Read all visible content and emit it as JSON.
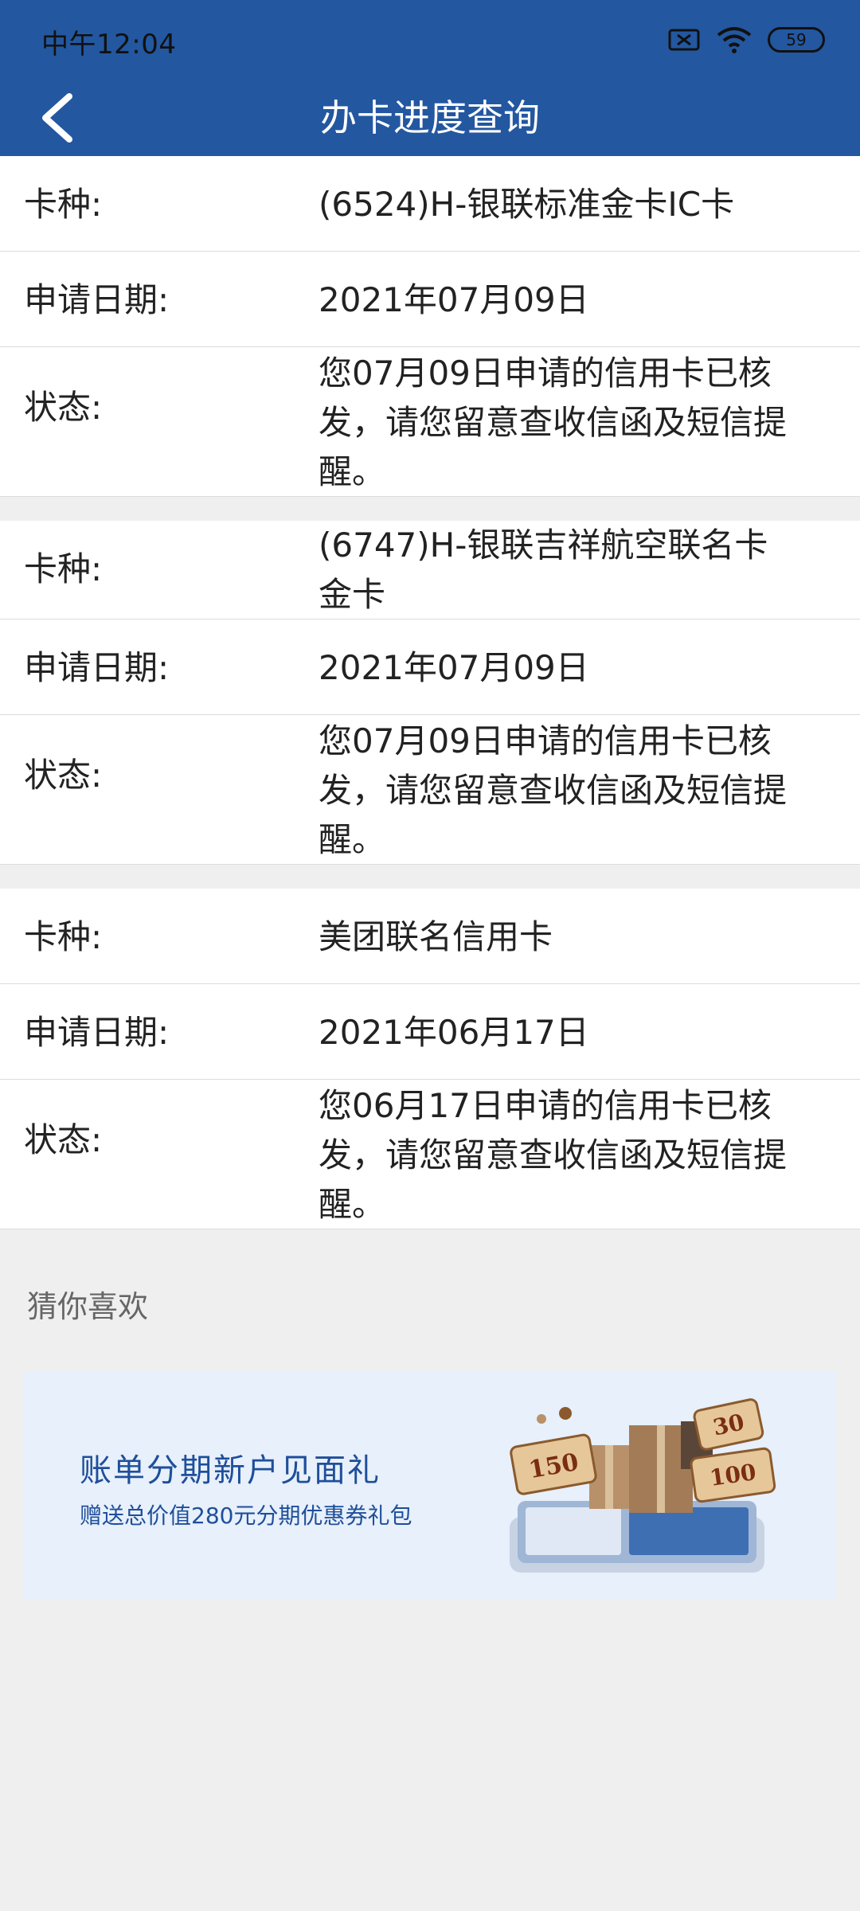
{
  "status_bar": {
    "time": "中午12:04",
    "battery": "59"
  },
  "header": {
    "title": "办卡进度查询"
  },
  "cards": [
    {
      "card_type_label": "卡种:",
      "card_type_value": "(6524)H-银联标准金卡IC卡",
      "date_label": "申请日期:",
      "date_value": "2021年07月09日",
      "status_label": "状态:",
      "status_value": "您07月09日申请的信用卡已核发，请您留意查收信函及短信提醒。"
    },
    {
      "card_type_label": "卡种:",
      "card_type_value": "(6747)H-银联吉祥航空联名卡金卡",
      "date_label": "申请日期:",
      "date_value": "2021年07月09日",
      "status_label": "状态:",
      "status_value": "您07月09日申请的信用卡已核发，请您留意查收信函及短信提醒。"
    },
    {
      "card_type_label": "卡种:",
      "card_type_value": "美团联名信用卡",
      "date_label": "申请日期:",
      "date_value": "2021年06月17日",
      "status_label": "状态:",
      "status_value": "您06月17日申请的信用卡已核发，请您留意查收信函及短信提醒。"
    }
  ],
  "recommend": {
    "title": "猜你喜欢",
    "banner": {
      "title": "账单分期新户见面礼",
      "subtitle": "赠送总价值280元分期优惠券礼包",
      "coupon_values": [
        "150",
        "30",
        "100"
      ]
    }
  },
  "colors": {
    "header_bg": "#2357a0",
    "page_bg": "#efeff0",
    "banner_bg": "#e7f0fb",
    "banner_text": "#1f4e9a"
  }
}
